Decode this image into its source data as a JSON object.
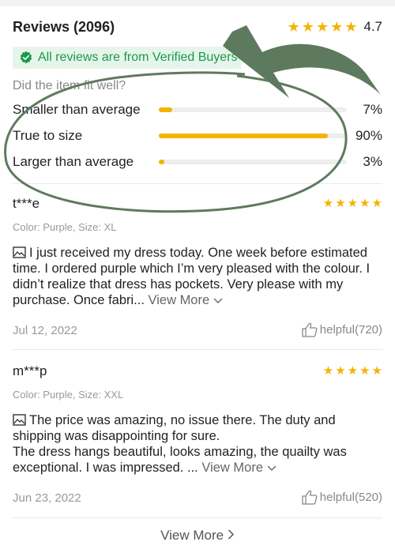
{
  "header": {
    "title": "Reviews (2096)",
    "rating_value": "4.7",
    "stars": 5
  },
  "verified_banner": {
    "text": "All reviews are from Verified Buyers"
  },
  "fit": {
    "question": "Did the item fit well?",
    "rows": [
      {
        "label": "Smaller than average",
        "percent_text": "7%",
        "percent": 7
      },
      {
        "label": "True to size",
        "percent_text": "90%",
        "percent": 90
      },
      {
        "label": "Larger than average",
        "percent_text": "3%",
        "percent": 3
      }
    ]
  },
  "reviews": [
    {
      "user": "t***e",
      "meta": "Color: Purple, Size: XL",
      "body": "I just received my dress today. One week before estimated time. I ordered purple which I’m very pleased with the colour. I didn’t realize that dress has pockets. Very please with my purchase. Once fabri...",
      "view_more": "View More",
      "date": "Jul 12, 2022",
      "helpful": "helpful(720)",
      "stars": 5
    },
    {
      "user": "m***p",
      "meta": "Color: Purple, Size: XXL",
      "body_line1": "The price was amazing, no issue there. The duty and shipping was disappointing for sure.",
      "body_line2": "The dress hangs beautiful, looks amazing, the quailty was exceptional. I was impressed. ...",
      "view_more": "View More",
      "date": "Jun 23, 2022",
      "helpful": "helpful(520)",
      "stars": 5
    }
  ],
  "footer": {
    "view_more": "View More"
  },
  "colors": {
    "accent_star": "#f5b301",
    "verified_green": "#1a9a4a",
    "annotation_green": "#5e7a5e"
  }
}
